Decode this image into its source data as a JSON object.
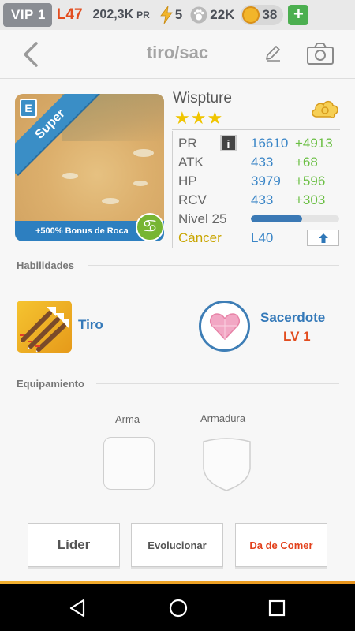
{
  "statusbar": {
    "vip": "VIP 1",
    "level": "L47",
    "pr_value": "202,3K",
    "pr_unit": "PR",
    "energy": "5",
    "paw": "22K",
    "coins": "38",
    "plus": "+"
  },
  "header": {
    "title": "tiro/sac"
  },
  "card": {
    "sash": "Super",
    "code": "E",
    "footer": "+500% Bonus de Roca",
    "zodiac_symbol": "♋"
  },
  "monster": {
    "name": "Wispture",
    "stars": "★★★",
    "stats": [
      {
        "label": "PR",
        "value": "16610",
        "bonus": "+4913"
      },
      {
        "label": "ATK",
        "value": "433",
        "bonus": "+68"
      },
      {
        "label": "HP",
        "value": "3979",
        "bonus": "+596"
      },
      {
        "label": "RCV",
        "value": "433",
        "bonus": "+303"
      }
    ],
    "info_icon": "i",
    "level_label": "Nivel 25",
    "level_progress": 0.58,
    "sign_label": "Cáncer",
    "sign_level": "L40"
  },
  "sections": {
    "skills": "Habilidades",
    "equipment": "Equipamiento"
  },
  "skills": {
    "skill1": "Tiro",
    "skill2": "Sacerdote",
    "skill2_level": "LV 1"
  },
  "equipment": {
    "weapon": "Arma",
    "armor": "Armadura"
  },
  "actions": {
    "leader": "Líder",
    "evolve": "Evolucionar",
    "feed": "Da de Comer"
  },
  "colors": {
    "accent_blue": "#3b86c7",
    "bonus_green": "#6abf43",
    "alert_red": "#e24d1f",
    "star_gold": "#f0c500"
  },
  "icons": [
    "back-icon",
    "pencil-icon",
    "camera-icon",
    "lightning-icon",
    "paw-icon",
    "coin-icon",
    "cloud-icon",
    "info-icon",
    "up-arrow-icon",
    "arrows-icon",
    "heart-icon",
    "nav-back-icon",
    "nav-home-icon",
    "nav-recent-icon"
  ]
}
